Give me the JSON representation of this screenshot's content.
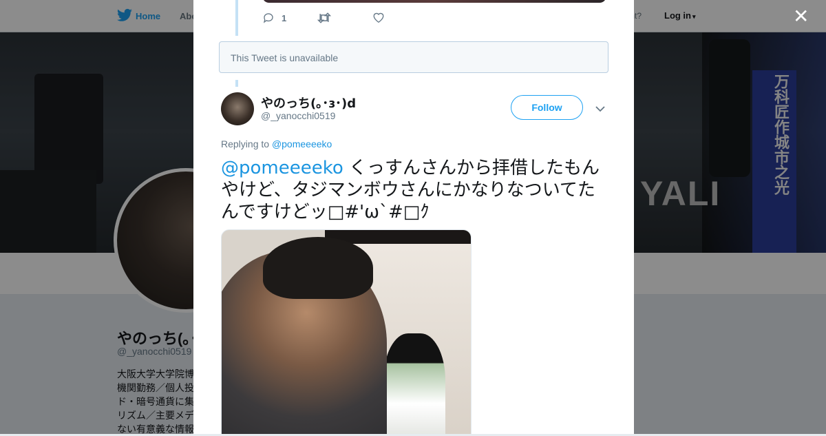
{
  "nav": {
    "home_label": "Home",
    "about_label": "Abo",
    "account_prompt": "ccount?",
    "login_label": "Log in"
  },
  "banner": {
    "sign_text": "万科匠作城市之光",
    "letters": "YALI"
  },
  "profile": {
    "name": "やのっち(｡･ɜ･)",
    "handle": "@_yanocchi0519",
    "bio": "大阪大学大学院博\n機関勤務／個人投\nド・暗号通貨に集\nリズム／主要メデ\nない有意義な情報"
  },
  "thread_prev": {
    "reply_count": "1"
  },
  "unavailable_text": "This Tweet is unavailable",
  "tweet": {
    "author_name": "やのっち(｡･ɜ･)d",
    "author_handle": "@_yanocchi0519",
    "follow_label": "Follow",
    "replying_prefix": "Replying to",
    "replying_to": "@pomeeeeko",
    "mention": "@pomeeeeko",
    "text": " くっすんさんから拝借したもんやけど、タジマンボウさんにかなりなついてたんですけどッ□#'ω`#□ｸ"
  },
  "colors": {
    "accent": "#1da1f2",
    "link": "#1b95e0",
    "muted": "#657786"
  },
  "icons": {
    "close": "close-icon",
    "reply": "reply-icon",
    "retweet": "retweet-icon",
    "like": "heart-icon",
    "caret": "chevron-down-icon",
    "logo": "twitter-bird-icon"
  }
}
